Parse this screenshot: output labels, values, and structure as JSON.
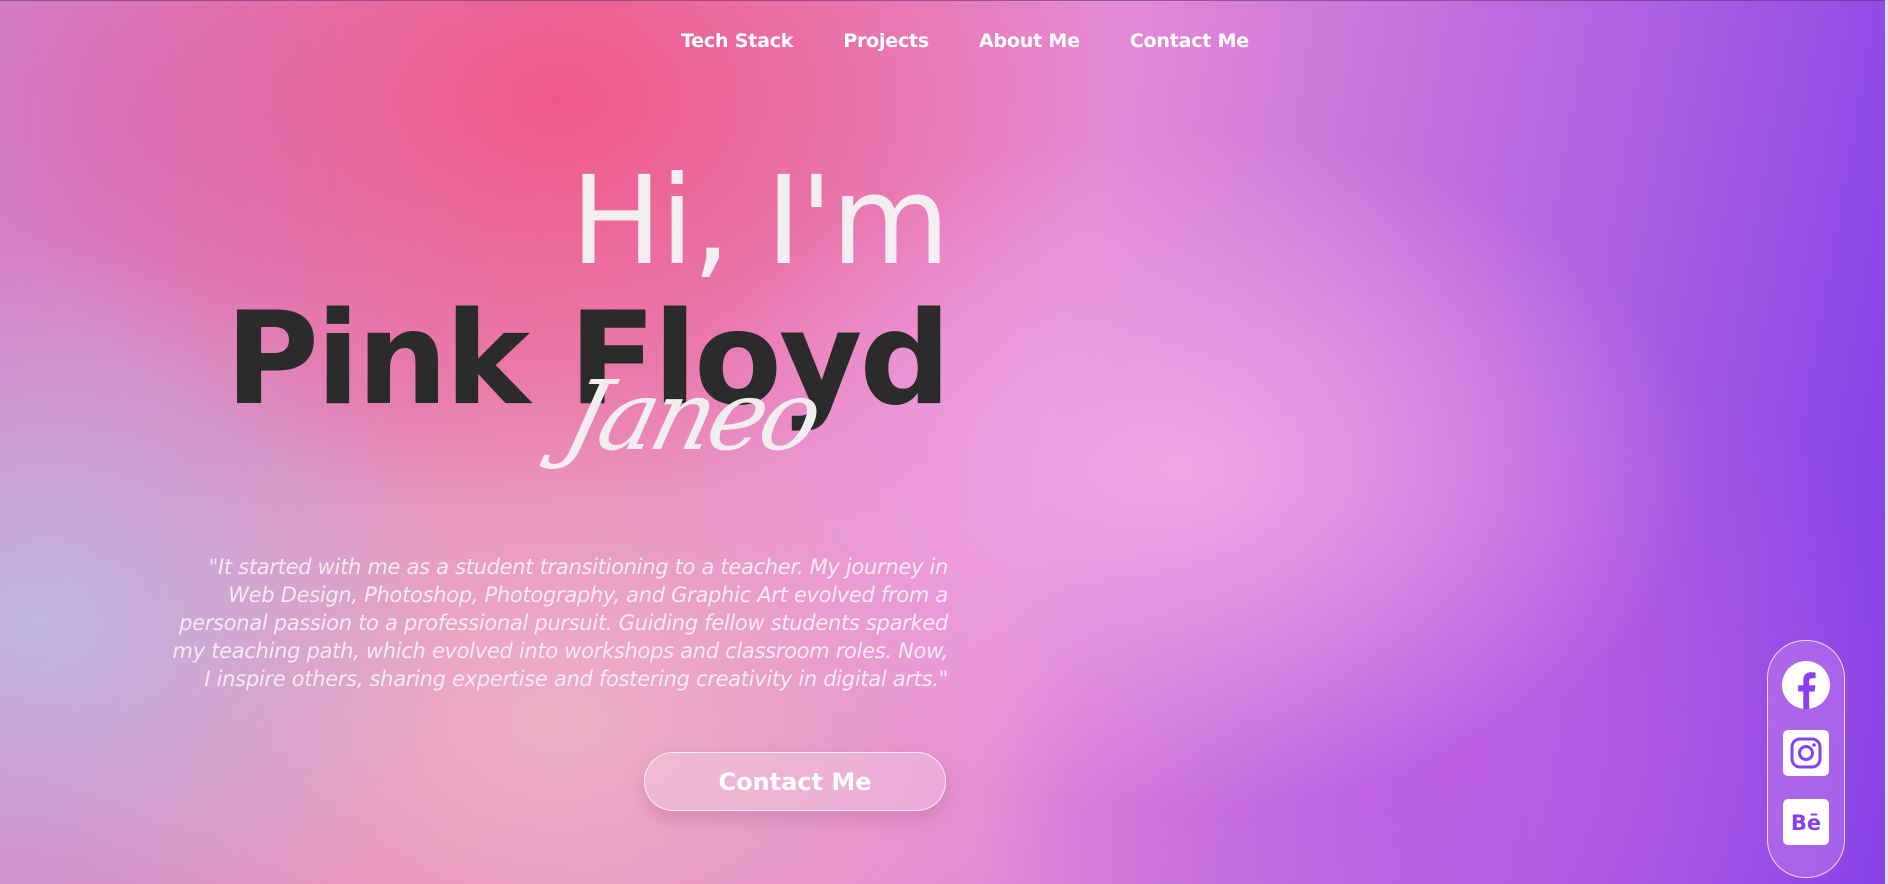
{
  "nav": {
    "items": [
      {
        "label": "Tech Stack"
      },
      {
        "label": "Projects"
      },
      {
        "label": "About Me"
      },
      {
        "label": "Contact Me"
      }
    ]
  },
  "hero": {
    "greeting": "Hi, I'm",
    "name": "Pink Floyd",
    "script_name": "Janeo",
    "quote": "\"It started with me as a student transitioning to a teacher. My journey in Web Design, Photoshop, Photography, and Graphic Art evolved from a personal passion to a professional pursuit. Guiding fellow students sparked my teaching path, which evolved into workshops and classroom roles. Now, I inspire others, sharing expertise and fostering creativity in digital arts.\"",
    "cta_label": "Contact Me"
  },
  "social": {
    "icons": [
      "facebook-icon",
      "instagram-icon",
      "behance-icon"
    ]
  },
  "colors": {
    "accent_purple": "#8a3ff0",
    "name_dark": "#2b2b2b",
    "text_light": "#f3eef0"
  }
}
